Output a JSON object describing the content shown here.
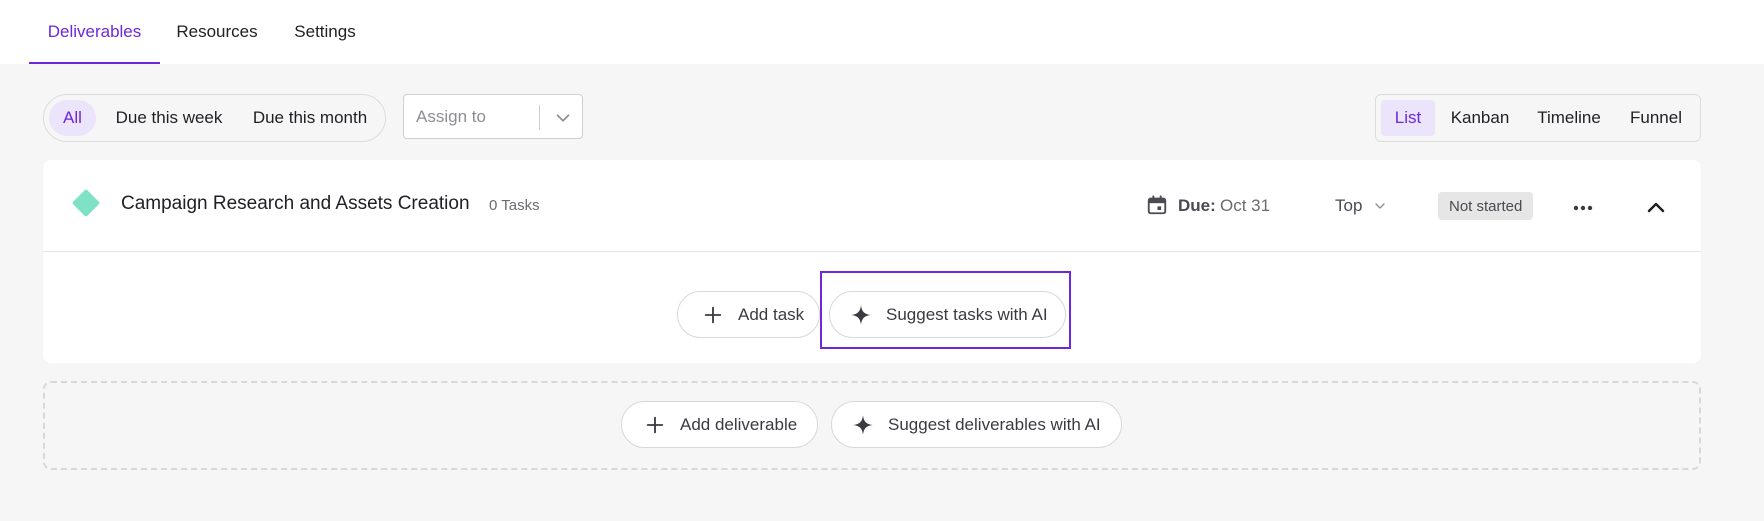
{
  "tabs": [
    {
      "label": "Deliverables",
      "active": true
    },
    {
      "label": "Resources",
      "active": false
    },
    {
      "label": "Settings",
      "active": false
    }
  ],
  "filters": {
    "options": [
      {
        "label": "All",
        "active": true
      },
      {
        "label": "Due this week",
        "active": false
      },
      {
        "label": "Due this month",
        "active": false
      }
    ],
    "assign_placeholder": "Assign to"
  },
  "views": [
    {
      "label": "List",
      "active": true
    },
    {
      "label": "Kanban",
      "active": false
    },
    {
      "label": "Timeline",
      "active": false
    },
    {
      "label": "Funnel",
      "active": false
    }
  ],
  "deliverable": {
    "title": "Campaign Research and Assets Creation",
    "task_count": "0 Tasks",
    "due_label": "Due:",
    "due_value": "Oct 31",
    "priority": "Top",
    "status": "Not started",
    "add_task_label": "Add task",
    "suggest_tasks_label": "Suggest tasks with AI"
  },
  "footer": {
    "add_deliverable_label": "Add deliverable",
    "suggest_deliverables_label": "Suggest deliverables with AI"
  },
  "colors": {
    "accent": "#6d28d9",
    "accent_bg": "#ebe4fb",
    "diamond": "#7fe2c6",
    "page_bg": "#f6f6f6"
  },
  "icons": [
    "calendar-icon",
    "chevron-down-icon",
    "more-icon",
    "chevron-up-icon",
    "plus-icon",
    "sparkle-icon"
  ]
}
